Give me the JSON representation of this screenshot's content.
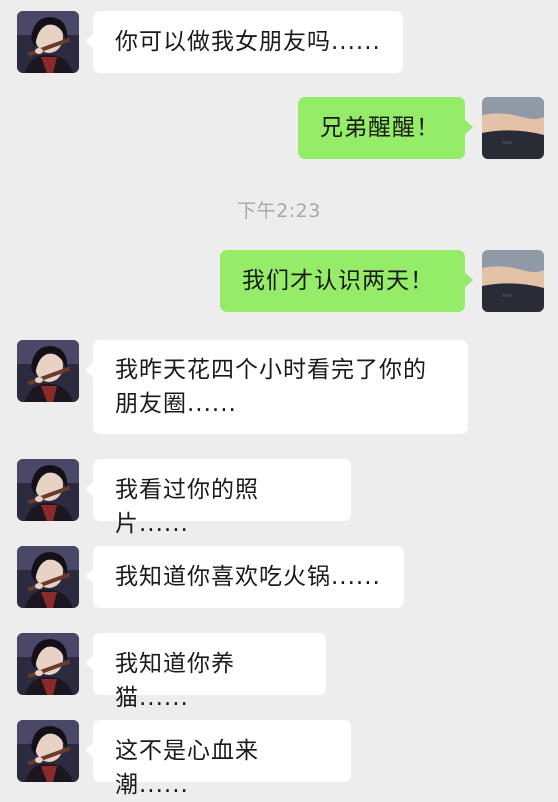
{
  "timestamp": "下午2:23",
  "messages": [
    {
      "side": "in",
      "sender": "contact",
      "text": "你可以做我女朋友吗......"
    },
    {
      "side": "out",
      "sender": "me",
      "text": "兄弟醒醒！"
    },
    {
      "side": "out",
      "sender": "me",
      "text": "我们才认识两天！"
    },
    {
      "side": "in",
      "sender": "contact",
      "text": "我昨天花四个小时看完了你的\n朋友圈......"
    },
    {
      "side": "in",
      "sender": "contact",
      "text": "我看过你的照片......"
    },
    {
      "side": "in",
      "sender": "contact",
      "text": "我知道你喜欢吃火锅......"
    },
    {
      "side": "in",
      "sender": "contact",
      "text": "我知道你养猫......"
    },
    {
      "side": "in",
      "sender": "contact",
      "text": "这不是心血来潮......"
    }
  ],
  "colors": {
    "background": "#ededed",
    "incoming_bubble": "#ffffff",
    "outgoing_bubble": "#95ec69",
    "timestamp": "#a8a8a8"
  },
  "icons": {
    "contact_avatar": "contact-avatar-icon",
    "my_avatar": "my-avatar-icon"
  }
}
